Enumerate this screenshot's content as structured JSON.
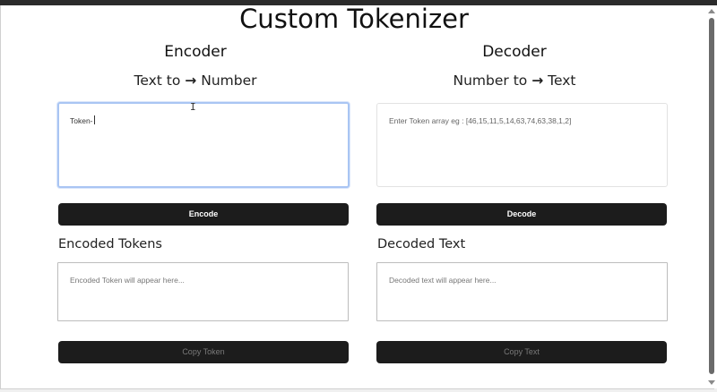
{
  "page": {
    "title": "Custom Tokenizer"
  },
  "encoder": {
    "heading": "Encoder",
    "subtitle_left": "Text to",
    "subtitle_arrow": "→",
    "subtitle_right": "Number",
    "input_value": "Token-",
    "button_label": "Encode",
    "output_label": "Encoded Tokens",
    "output_placeholder": "Encoded Token will appear here...",
    "copy_label": "Copy Token"
  },
  "decoder": {
    "heading": "Decoder",
    "subtitle_left": "Number to",
    "subtitle_arrow": "→",
    "subtitle_right": "Text",
    "input_placeholder": "Enter Token array eg : [46,15,11,5,14,63,74,63,38,1,2]",
    "button_label": "Decode",
    "output_label": "Decoded Text",
    "output_placeholder": "Decoded text will appear here...",
    "copy_label": "Copy Text"
  },
  "icons": {
    "text_cursor": "I-beam cursor"
  },
  "colors": {
    "button_bg": "#1c1c1c",
    "focus_border": "#a9c5f3"
  }
}
